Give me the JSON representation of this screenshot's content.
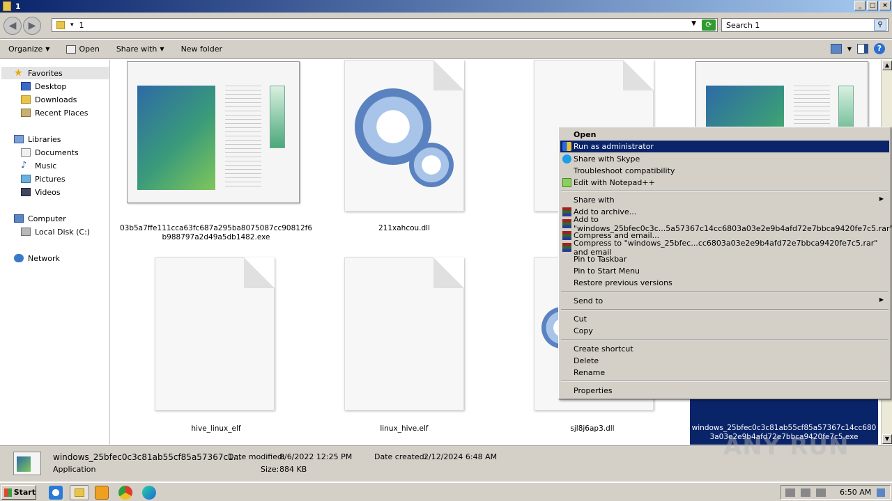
{
  "window": {
    "title": "1"
  },
  "address": {
    "path": "1"
  },
  "search": {
    "placeholder": "Search 1"
  },
  "toolbar": {
    "organize": "Organize",
    "open": "Open",
    "share_with": "Share with",
    "new_folder": "New folder"
  },
  "sidebar": {
    "favorites": "Favorites",
    "desktop": "Desktop",
    "downloads": "Downloads",
    "recent": "Recent Places",
    "libraries": "Libraries",
    "documents": "Documents",
    "music": "Music",
    "pictures": "Pictures",
    "videos": "Videos",
    "computer": "Computer",
    "local_disk": "Local Disk (C:)",
    "network": "Network"
  },
  "files": [
    {
      "name": "03b5a7ffe111cca63fc687a295ba8075087cc90812f6b988797a2d49a5db1482.exe",
      "kind": "exe"
    },
    {
      "name": "211xahcou.dll",
      "kind": "dll"
    },
    {
      "name": "",
      "kind": "doc"
    },
    {
      "name": "windows_25bfec0c3c81ab55cf85a57367c14cc6803a03e2e9b4afd72e7bbca9420fe7c5.exe",
      "kind": "exe"
    },
    {
      "name": "hive_linux_elf",
      "kind": "doc"
    },
    {
      "name": "linux_hive.elf",
      "kind": "doc"
    },
    {
      "name": "sjl8j6ap3.dll",
      "kind": "dll"
    }
  ],
  "context_menu": {
    "open": "Open",
    "run_as_admin": "Run as administrator",
    "share_skype": "Share with Skype",
    "troubleshoot": "Troubleshoot compatibility",
    "notepad": "Edit with Notepad++",
    "share_with": "Share with",
    "add_archive": "Add to archive...",
    "add_rar": "Add to \"windows_25bfec0c3c...5a57367c14cc6803a03e2e9b4afd72e7bbca9420fe7c5.rar\"",
    "compress_email": "Compress and email...",
    "compress_rar_email": "Compress to \"windows_25bfec...cc6803a03e2e9b4afd72e7bbca9420fe7c5.rar\" and email",
    "pin_taskbar": "Pin to Taskbar",
    "pin_start": "Pin to Start Menu",
    "restore": "Restore previous versions",
    "send_to": "Send to",
    "cut": "Cut",
    "copy": "Copy",
    "create_shortcut": "Create shortcut",
    "delete": "Delete",
    "rename": "Rename",
    "properties": "Properties"
  },
  "details": {
    "filename": "windows_25bfec0c3c81ab55cf85a57367c1...",
    "type": "Application",
    "date_modified_label": "Date modified:",
    "date_modified": "8/6/2022 12:25 PM",
    "date_created_label": "Date created:",
    "date_created": "2/12/2024 6:48 AM",
    "size_label": "Size:",
    "size": "884 KB"
  },
  "taskbar": {
    "start": "Start",
    "clock": "6:50 AM"
  },
  "watermark": "ANY RUN"
}
